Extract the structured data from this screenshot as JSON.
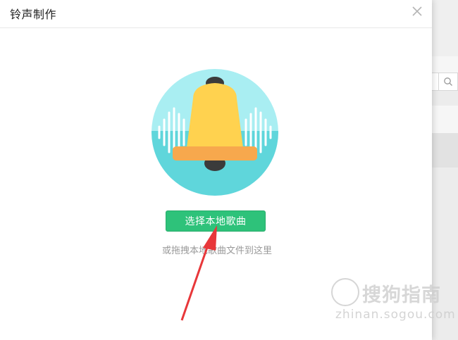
{
  "dialog": {
    "title": "铃声制作",
    "close_icon": "close-icon"
  },
  "illustration": {
    "icon": "bell-icon",
    "colors": {
      "circle_top": "#a9eef2",
      "circle_bottom": "#5fd6db",
      "bell_body": "#ffd24f",
      "bell_rim": "#f7a84d",
      "bell_knob": "#3b3b3b"
    }
  },
  "actions": {
    "select_label": "选择本地歌曲",
    "drag_hint": "或拖拽本地歌曲文件到这里"
  },
  "background": {
    "search_icon": "search-icon"
  },
  "watermark": {
    "text": "搜狗指南",
    "url": "zhinan.sogou.com"
  },
  "colors": {
    "accent": "#2ec27a",
    "arrow": "#e8373a"
  }
}
